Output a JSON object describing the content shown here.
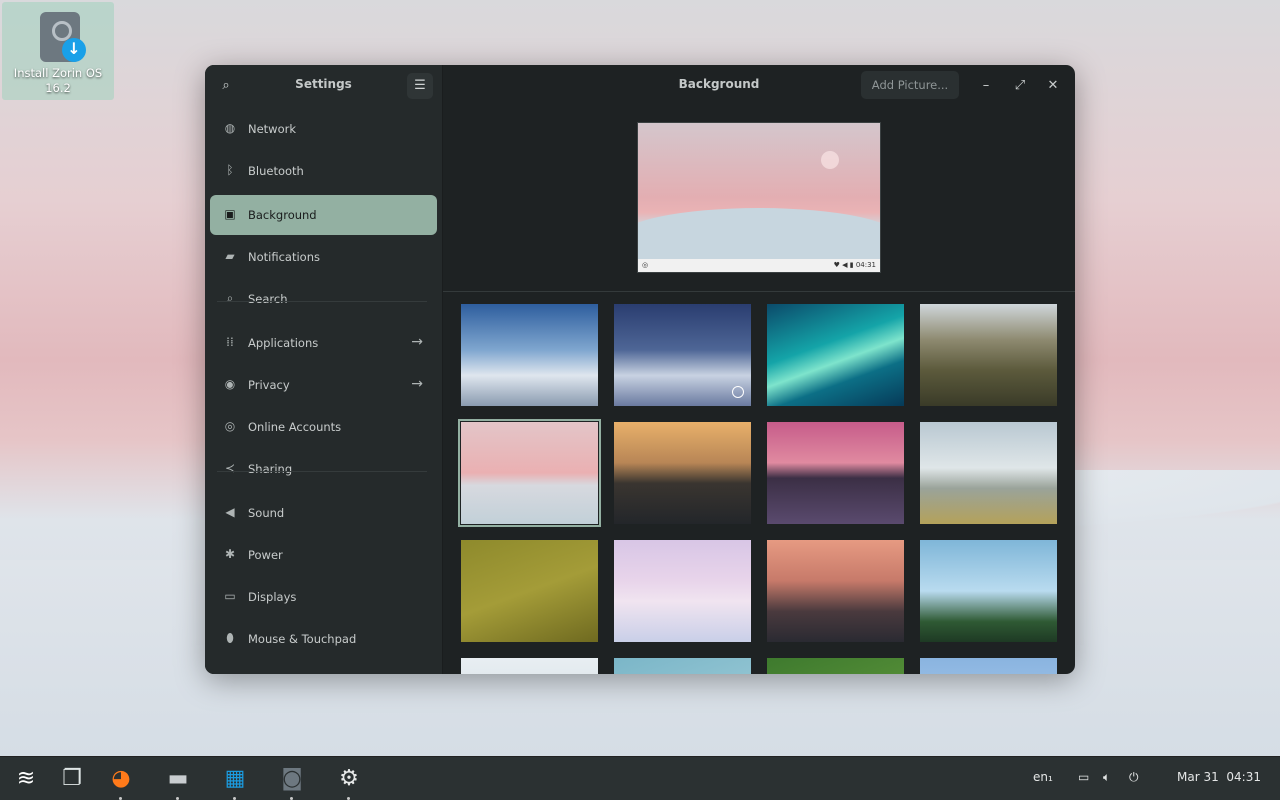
{
  "desktop": {
    "icon_label": "Install Zorin OS 16.2"
  },
  "window": {
    "sidebar_title": "Settings",
    "header_title": "Background",
    "add_picture_label": "Add Picture...",
    "controls": {
      "minimize": "–",
      "maximize": "⤢",
      "close": "✕"
    }
  },
  "sidebar": {
    "items": [
      {
        "label": "Network",
        "icon": "network-icon",
        "glyph": "◍",
        "active": false,
        "arrow": false
      },
      {
        "label": "Bluetooth",
        "icon": "bluetooth-icon",
        "glyph": "ᛒ",
        "active": false,
        "arrow": false
      },
      {
        "label": "Background",
        "icon": "background-icon",
        "glyph": "▣",
        "active": true,
        "arrow": false
      },
      {
        "label": "Notifications",
        "icon": "notifications-icon",
        "glyph": "▰",
        "active": false,
        "arrow": false
      },
      {
        "label": "Search",
        "icon": "search-icon",
        "glyph": "⌕",
        "active": false,
        "arrow": false
      },
      {
        "label": "Applications",
        "icon": "applications-icon",
        "glyph": "⁞⁞",
        "active": false,
        "arrow": true
      },
      {
        "label": "Privacy",
        "icon": "privacy-icon",
        "glyph": "◉",
        "active": false,
        "arrow": true
      },
      {
        "label": "Online Accounts",
        "icon": "online-accounts-icon",
        "glyph": "◎",
        "active": false,
        "arrow": false
      },
      {
        "label": "Sharing",
        "icon": "sharing-icon",
        "glyph": "≺",
        "active": false,
        "arrow": false
      },
      {
        "label": "Sound",
        "icon": "sound-icon",
        "glyph": "◀",
        "active": false,
        "arrow": false
      },
      {
        "label": "Power",
        "icon": "power-icon",
        "glyph": "✱",
        "active": false,
        "arrow": false
      },
      {
        "label": "Displays",
        "icon": "displays-icon",
        "glyph": "▭",
        "active": false,
        "arrow": false
      },
      {
        "label": "Mouse & Touchpad",
        "icon": "mouse-icon",
        "glyph": "⬮",
        "active": false,
        "arrow": false
      }
    ]
  },
  "preview": {
    "bar_time": "04:31"
  },
  "wallpapers": [
    {
      "name": "mountain-day",
      "selected": false,
      "current": false,
      "bg": "linear-gradient(180deg,#2e5e9e 0%,#7fa6cf 45%,#dfe6ee 70%,#8a9bb0 100%)"
    },
    {
      "name": "mountain-dusk",
      "selected": false,
      "current": true,
      "bg": "linear-gradient(180deg,#2a3d70 0%,#4e6696 45%,#c8d2e2 70%,#6a7aa0 100%)"
    },
    {
      "name": "aurora",
      "selected": false,
      "current": false,
      "bg": "linear-gradient(160deg,#0b4a6a 0%,#14a4a8 40%,#7ee4cc 55%,#0c6f86 70%,#063a58 100%)"
    },
    {
      "name": "canyon",
      "selected": false,
      "current": false,
      "bg": "linear-gradient(180deg,#cfd6da 0%,#8e8a70 35%,#5c5a3c 65%,#3a3b28 100%)"
    },
    {
      "name": "dunes",
      "selected": true,
      "current": false,
      "bg": "linear-gradient(180deg,#e3c5c8 0%,#eab0b2 50%,#d7d9df 62%,#c2d0d8 100%)"
    },
    {
      "name": "mountain-sunset",
      "selected": false,
      "current": false,
      "bg": "linear-gradient(180deg,#e8b06a 0%,#b88656 40%,#3a3530 60%,#23262a 100%)"
    },
    {
      "name": "lighthouse",
      "selected": false,
      "current": false,
      "bg": "linear-gradient(180deg,#c65c8a 0%,#e08aa0 40%,#3b2f45 55%,#5a4a6e 100%)"
    },
    {
      "name": "coast-fog",
      "selected": false,
      "current": false,
      "bg": "linear-gradient(180deg,#b9c8d2 0%,#dfe6e8 45%,#9aa39a 65%,#b4a25a 100%)"
    },
    {
      "name": "field",
      "selected": false,
      "current": false,
      "bg": "linear-gradient(160deg,#8e8a2c 0%,#a49c38 50%,#6f6a20 100%)"
    },
    {
      "name": "clouds",
      "selected": false,
      "current": false,
      "bg": "linear-gradient(180deg,#d8c6e6 0%,#e8d4ea 40%,#f0e4f0 60%,#c9cfe8 100%)"
    },
    {
      "name": "city",
      "selected": false,
      "current": false,
      "bg": "linear-gradient(180deg,#e69a82 0%,#c77a6a 40%,#4a3a3e 70%,#2a2a32 100%)"
    },
    {
      "name": "palms",
      "selected": false,
      "current": false,
      "bg": "linear-gradient(180deg,#7fb6d8 0%,#b9dbef 50%,#2f5a34 80%,#1e3a24 100%)"
    },
    {
      "name": "partial-1",
      "selected": false,
      "current": false,
      "bg": "linear-gradient(180deg,#e8eef2 0%,#c8d6de 100%)"
    },
    {
      "name": "partial-2",
      "selected": false,
      "current": false,
      "bg": "linear-gradient(160deg,#7bb6c8 0%,#a8d2dc 100%)"
    },
    {
      "name": "partial-3",
      "selected": false,
      "current": false,
      "bg": "linear-gradient(160deg,#3e7a2e 0%,#6aa040 100%)"
    },
    {
      "name": "partial-4",
      "selected": false,
      "current": false,
      "bg": "linear-gradient(180deg,#8ab4e0 0%,#b8d4f0 100%)"
    }
  ],
  "taskbar": {
    "apps": [
      {
        "name": "zorin-menu-icon",
        "color": "#ffffff"
      },
      {
        "name": "workspaces-icon",
        "color": "#dfe6e6"
      },
      {
        "name": "firefox-icon",
        "color": "#ff7a1a"
      },
      {
        "name": "files-icon",
        "color": "#c9cdd0"
      },
      {
        "name": "software-store-icon",
        "color": "#1b9be0"
      },
      {
        "name": "installer-icon",
        "color": "#6d7880"
      },
      {
        "name": "settings-icon",
        "color": "#e6e8e8"
      }
    ],
    "language": "en₁",
    "date": "Mar 31",
    "time": "04:31"
  }
}
